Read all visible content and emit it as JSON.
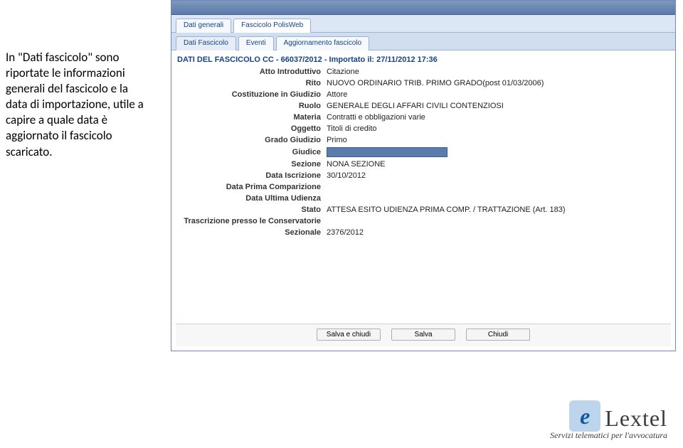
{
  "sidebar_text": "In \"Dati fascicolo\" sono riportate le informazioni generali del fascicolo e la data di importazione, utile a capire a quale data è aggiornato il fascicolo scaricato.",
  "tabs_top": [
    {
      "label": "Dati generali"
    },
    {
      "label": "Fascicolo PolisWeb"
    }
  ],
  "tabs_top_active": 1,
  "tabs_sub": [
    {
      "label": "Dati Fascicolo"
    },
    {
      "label": "Eventi"
    },
    {
      "label": "Aggiornamento fascicolo"
    }
  ],
  "tabs_sub_active": 0,
  "section_title": "DATI DEL FASCICOLO CC - 66037/2012 - Importato il: 27/11/2012 17:36",
  "fields": [
    {
      "label": "Atto Introduttivo",
      "value": "Citazione"
    },
    {
      "label": "Rito",
      "value": "NUOVO ORDINARIO TRIB. PRIMO GRADO(post 01/03/2006)"
    },
    {
      "label": "Costituzione in Giudizio",
      "value": "Attore"
    },
    {
      "label": "Ruolo",
      "value": "GENERALE DEGLI AFFARI CIVILI CONTENZIOSI"
    },
    {
      "label": "Materia",
      "value": "Contratti e obbligazioni varie"
    },
    {
      "label": "Oggetto",
      "value": "Titoli di credito"
    },
    {
      "label": "Grado Giudizio",
      "value": "Primo"
    },
    {
      "label": "Giudice",
      "value": "",
      "redacted": true
    },
    {
      "label": "Sezione",
      "value": "NONA SEZIONE"
    },
    {
      "label": "Data Iscrizione",
      "value": "30/10/2012"
    },
    {
      "label": "Data Prima Comparizione",
      "value": ""
    },
    {
      "label": "Data Ultima Udienza",
      "value": ""
    },
    {
      "label": "Stato",
      "value": "ATTESA ESITO UDIENZA PRIMA COMP. / TRATTAZIONE (Art. 183)"
    },
    {
      "label": "Trascrizione presso le Conservatorie",
      "value": ""
    },
    {
      "label": "Sezionale",
      "value": "2376/2012"
    }
  ],
  "buttons": {
    "save_close": "Salva e chiudi",
    "save": "Salva",
    "close": "Chiudi"
  },
  "logo": {
    "name": "Lextel",
    "tagline": "Servizi telematici per l'avvocatura"
  }
}
